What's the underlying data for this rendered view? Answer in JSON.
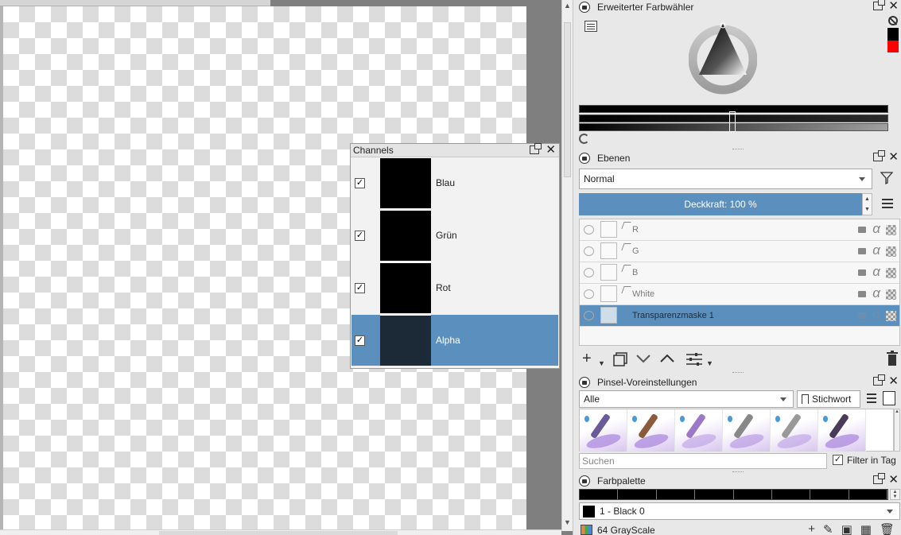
{
  "channels": {
    "title": "Channels",
    "rows": [
      {
        "label": "Blau",
        "checked": true
      },
      {
        "label": "Grün",
        "checked": true
      },
      {
        "label": "Rot",
        "checked": true
      },
      {
        "label": "Alpha",
        "checked": true,
        "selected": true
      }
    ]
  },
  "color_selector": {
    "title": "Erweiterter Farbwähler",
    "foreground": "#000000",
    "background": "#ff0000"
  },
  "layers": {
    "title": "Ebenen",
    "blend_mode": "Normal",
    "opacity_label": "Deckkraft:  100 %",
    "items": [
      {
        "name": "R",
        "selected": false
      },
      {
        "name": "G",
        "selected": false
      },
      {
        "name": "B",
        "selected": false
      },
      {
        "name": "White",
        "selected": false
      },
      {
        "name": "Transparenzmaske 1",
        "selected": true
      }
    ]
  },
  "brush_presets": {
    "title": "Pinsel-Voreinstellungen",
    "filter": "Alle",
    "tag_button": "Stichwort",
    "search_placeholder": "Suchen",
    "filter_in_tag_label": "Filter in Tag",
    "filter_in_tag_checked": true
  },
  "palette": {
    "title": "Farbpalette",
    "selected_color": "1 - Black 0",
    "palette_name": "64 GrayScale"
  },
  "colors": {
    "accent": "#5b8fbd"
  }
}
